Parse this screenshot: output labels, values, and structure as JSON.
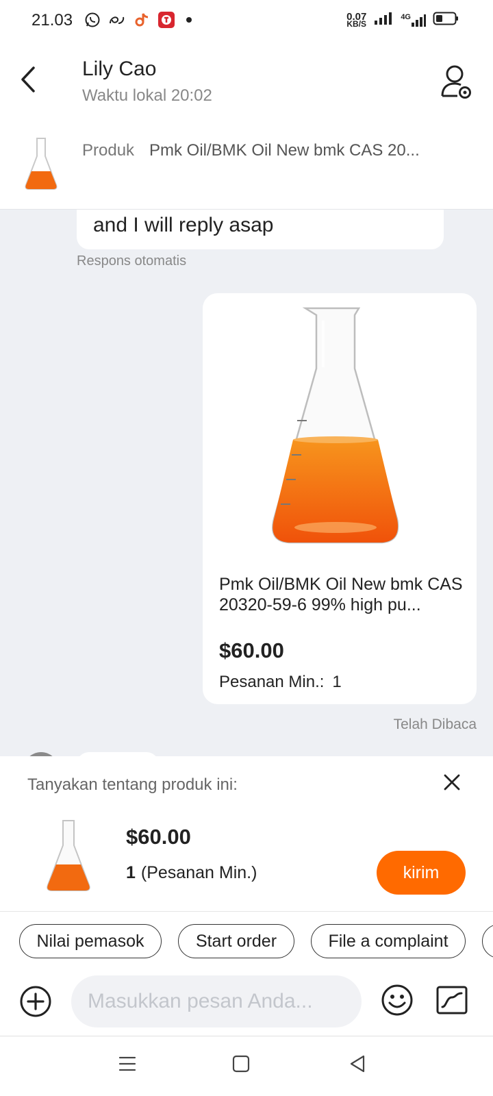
{
  "status_bar": {
    "time": "21.03",
    "net_speed_value": "0.07",
    "net_speed_unit": "KB/S",
    "network_label": "4G"
  },
  "header": {
    "contact_name": "Lily Cao",
    "local_time": "Waktu lokal 20:02"
  },
  "product_strip": {
    "label": "Produk",
    "title": "Pmk Oil/BMK Oil New bmk CAS 20..."
  },
  "chat": {
    "incoming_text": "and I will reply asap",
    "auto_response_label": "Respons otomatis",
    "product_card": {
      "title": "Pmk Oil/BMK Oil New bmk CAS 20320-59-6 99% high pu...",
      "price": "$60.00",
      "min_order_label": "Pesanan Min.:",
      "min_order_value": "1"
    },
    "read_status": "Telah Dibaca"
  },
  "ask_panel": {
    "title": "Tanyakan tentang produk ini:",
    "price": "$60.00",
    "min_qty": "1",
    "min_label": "(Pesanan Min.)",
    "send_label": "kirim"
  },
  "quick_replies": [
    "Nilai pemasok",
    "Start order",
    "File a complaint"
  ],
  "input": {
    "placeholder": "Masukkan pesan Anda..."
  },
  "colors": {
    "accent": "#ff6a00",
    "chat_bg": "#eef0f4",
    "liquid": "#f26a10"
  },
  "icons": {
    "back": "chevron-left-icon",
    "profile": "user-settings-icon",
    "close": "close-icon",
    "plus": "plus-circle-icon",
    "emoji": "smiley-icon",
    "image": "image-icon",
    "nav_menu": "menu-icon",
    "nav_home": "square-icon",
    "nav_back": "triangle-back-icon"
  }
}
